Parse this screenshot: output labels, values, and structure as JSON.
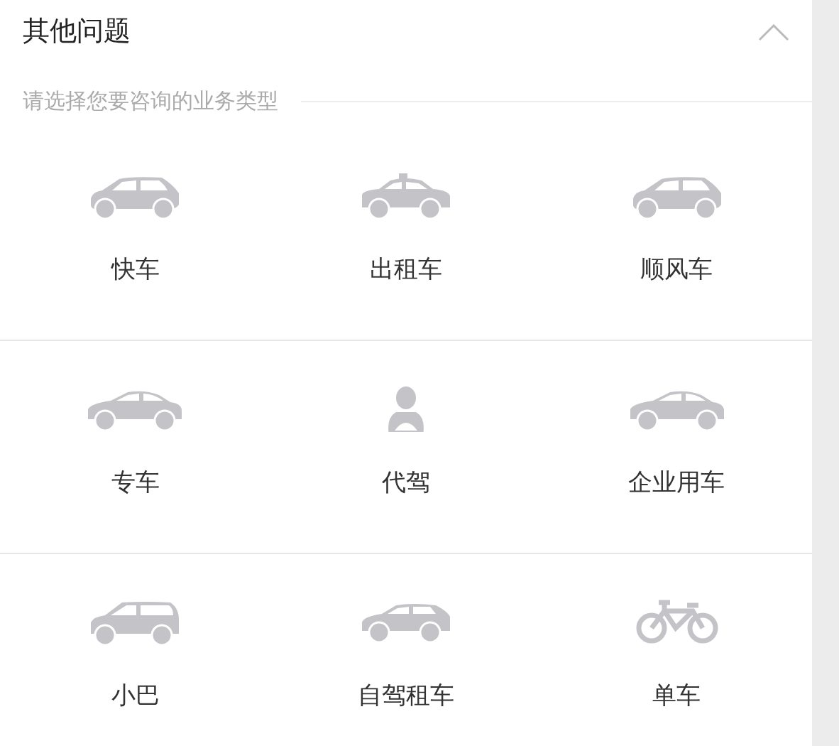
{
  "section": {
    "title": "其他问题",
    "expanded": true,
    "subtitle": "请选择您要咨询的业务类型"
  },
  "services": [
    {
      "label": "快车",
      "kind": "hatchback"
    },
    {
      "label": "出租车",
      "kind": "taxi"
    },
    {
      "label": "顺风车",
      "kind": "hatchback"
    },
    {
      "label": "专车",
      "kind": "sedan"
    },
    {
      "label": "代驾",
      "kind": "driver"
    },
    {
      "label": "企业用车",
      "kind": "sedan"
    },
    {
      "label": "小巴",
      "kind": "van"
    },
    {
      "label": "自驾租车",
      "kind": "suv"
    },
    {
      "label": "单车",
      "kind": "bike"
    }
  ]
}
